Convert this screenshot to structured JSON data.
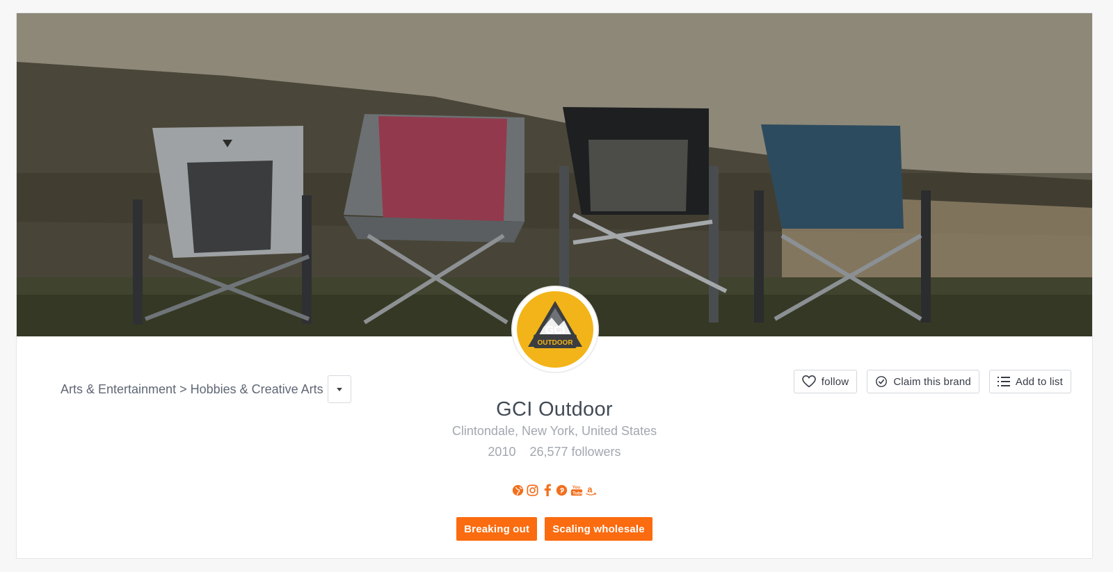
{
  "brand": {
    "name": "GCI Outdoor",
    "logo_text_top": "GCI",
    "logo_text_bottom": "OUTDOOR",
    "location": "Clintondale, New York, United States",
    "founded": "2010",
    "followers": "26,577 followers"
  },
  "breadcrumb": {
    "text": "Arts & Entertainment > Hobbies & Creative Arts"
  },
  "actions": {
    "follow": "follow",
    "claim": "Claim this brand",
    "add_to_list": "Add to list"
  },
  "socials": [
    "globe-icon",
    "instagram-icon",
    "facebook-icon",
    "pinterest-icon",
    "youtube-icon",
    "amazon-icon"
  ],
  "tags": [
    "Breaking out",
    "Scaling wholesale"
  ],
  "colors": {
    "accent": "#fb6b0f",
    "social": "#f26f1d",
    "logo_bg": "#f2b418"
  }
}
